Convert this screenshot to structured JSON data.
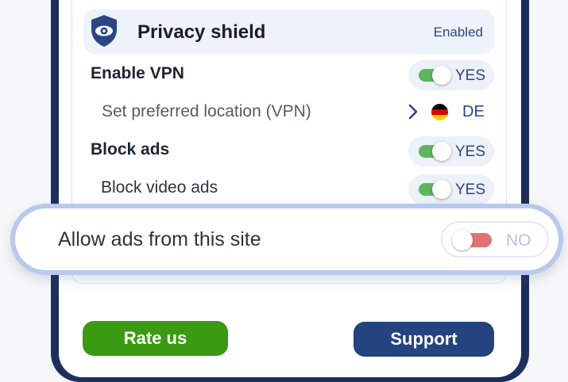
{
  "shield": {
    "title": "Privacy shield",
    "status": "Enabled",
    "icon": "eye-shield-icon"
  },
  "settings": {
    "vpn": {
      "label": "Enable VPN",
      "toggle": "YES",
      "on": true
    },
    "location": {
      "label": "Set preferred location (VPN)",
      "value": "DE",
      "flag": "germany-flag-icon"
    },
    "block_ads": {
      "label": "Block ads",
      "toggle": "YES",
      "on": true
    },
    "block_video_ads": {
      "label": "Block video ads",
      "toggle": "YES",
      "on": true
    }
  },
  "highlight": {
    "label": "Allow ads from this site",
    "toggle": "NO",
    "on": false
  },
  "buttons": {
    "rate": "Rate us",
    "support": "Support"
  },
  "colors": {
    "frame": "#1c2f5c",
    "accent_blue": "#2b4585",
    "toggle_on": "#5cb85c",
    "toggle_off": "#e07474",
    "rate_button": "#3a9a11",
    "support_button": "#24437f",
    "highlight_border": "#b9c9ec"
  }
}
